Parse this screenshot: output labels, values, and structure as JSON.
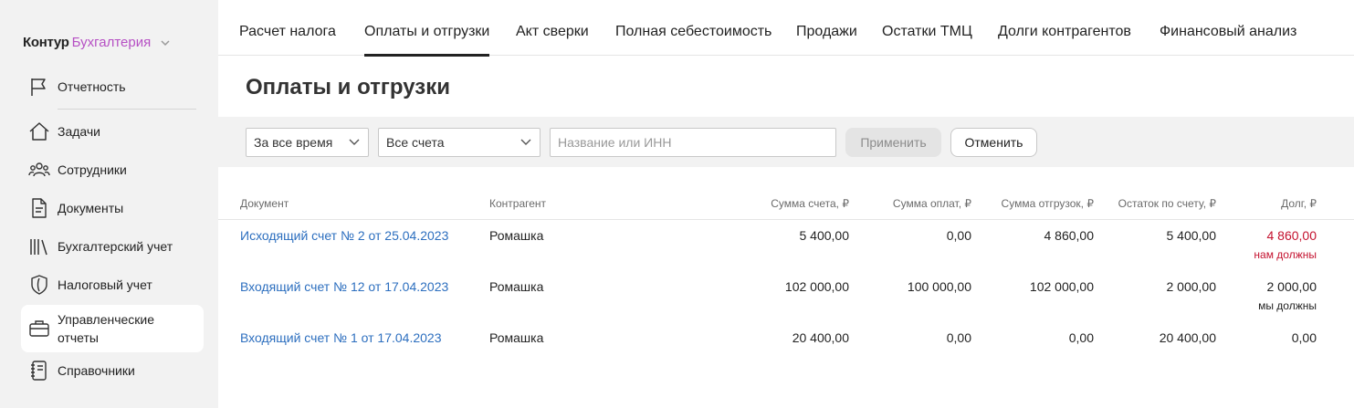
{
  "logo": {
    "brand": "Контур",
    "product": "Бухгалтерия"
  },
  "sidebar": {
    "items": [
      {
        "label": "Отчетность",
        "icon": "flag-icon"
      },
      {
        "label": "Задачи",
        "icon": "home-icon"
      },
      {
        "label": "Сотрудники",
        "icon": "people-icon"
      },
      {
        "label": "Документы",
        "icon": "document-icon"
      },
      {
        "label": "Бухгалтерский учет",
        "icon": "books-icon"
      },
      {
        "label": "Налоговый учет",
        "icon": "shield-icon"
      },
      {
        "label": "Управленческие отчеты",
        "icon": "briefcase-icon"
      },
      {
        "label": "Справочники",
        "icon": "notebook-icon"
      }
    ]
  },
  "tabs": [
    {
      "label": "Расчет налога"
    },
    {
      "label": "Оплаты и отгрузки"
    },
    {
      "label": "Акт сверки"
    },
    {
      "label": "Полная себестоимость"
    },
    {
      "label": "Продажи"
    },
    {
      "label": "Остатки ТМЦ"
    },
    {
      "label": "Долги контрагентов"
    },
    {
      "label": "Финансовый анализ"
    }
  ],
  "page": {
    "title": "Оплаты и отгрузки"
  },
  "filters": {
    "period": "За все время",
    "accounts": "Все счета",
    "search_placeholder": "Название или ИНН",
    "apply_label": "Применить",
    "cancel_label": "Отменить"
  },
  "table": {
    "headers": {
      "document": "Документ",
      "counterparty": "Контрагент",
      "invoice_sum": "Сумма счета, ₽",
      "payments_sum": "Сумма оплат, ₽",
      "shipments_sum": "Сумма отгрузок, ₽",
      "balance": "Остаток по счету, ₽",
      "debt": "Долг, ₽"
    },
    "rows": [
      {
        "document": "Исходящий счет № 2 от 25.04.2023",
        "counterparty": "Ромашка",
        "invoice_sum": "5 400,00",
        "payments_sum": "0,00",
        "shipments_sum": "4 860,00",
        "balance": "5 400,00",
        "debt": "4 860,00",
        "debt_note": "нам должны"
      },
      {
        "document": "Входящий счет № 12 от 17.04.2023",
        "counterparty": "Ромашка",
        "invoice_sum": "102 000,00",
        "payments_sum": "100 000,00",
        "shipments_sum": "102 000,00",
        "balance": "2 000,00",
        "debt": "2 000,00",
        "debt_note": "мы должны"
      },
      {
        "document": "Входящий счет № 1 от 17.04.2023",
        "counterparty": "Ромашка",
        "invoice_sum": "20 400,00",
        "payments_sum": "0,00",
        "shipments_sum": "0,00",
        "balance": "20 400,00",
        "debt": "0,00",
        "debt_note": ""
      }
    ]
  },
  "colors": {
    "accent_product": "#b650c4",
    "link": "#2d6fbf",
    "debt_red": "#c4122f"
  }
}
